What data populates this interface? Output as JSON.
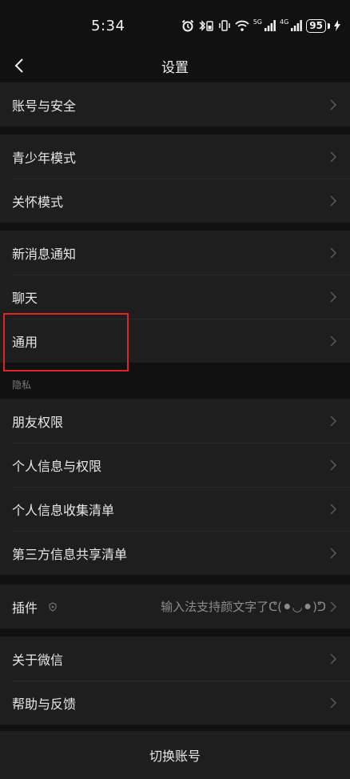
{
  "status_bar": {
    "time": "5:34",
    "sig1_label": "5G",
    "sig2_label": "4G",
    "battery": "95"
  },
  "nav": {
    "title": "设置"
  },
  "sections": {
    "privacy_label": "隐私"
  },
  "items": {
    "account_security": "账号与安全",
    "teen_mode": "青少年模式",
    "care_mode": "关怀模式",
    "notifications": "新消息通知",
    "chat": "聊天",
    "general": "通用",
    "friend_permissions": "朋友权限",
    "personal_info_permissions": "个人信息与权限",
    "personal_info_collection": "个人信息收集清单",
    "third_party_sharing": "第三方信息共享清单",
    "plugins": "插件",
    "plugins_value": "输入法支持颜文字了ᕦ(⚫◡⚫)ᕤ",
    "about": "关于微信",
    "help_feedback": "帮助与反馈"
  },
  "footer": {
    "switch_account": "切换账号"
  },
  "colors": {
    "background": "#111111",
    "row_background": "#1e1e1e",
    "highlight": "#e02424"
  }
}
